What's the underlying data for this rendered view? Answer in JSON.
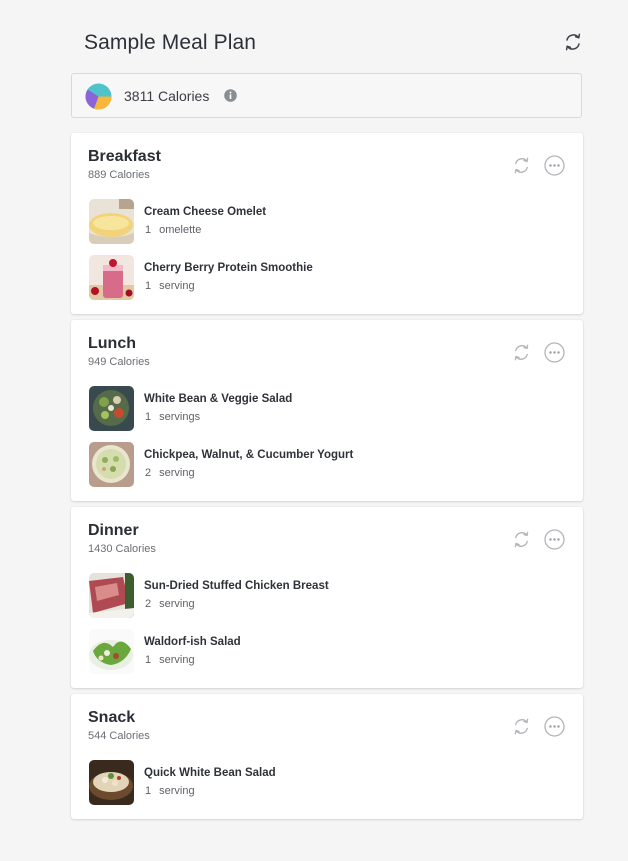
{
  "page": {
    "title": "Sample Meal Plan",
    "refresh_icon": "refresh-icon"
  },
  "summary": {
    "calories_text": "3811 Calories",
    "pie_icon": "macro-pie-chart-icon",
    "info_icon": "info-icon",
    "pie_colors": [
      "#4fc3c9",
      "#f6b73c",
      "#8d63d9"
    ]
  },
  "meals": [
    {
      "title": "Breakfast",
      "calories": "889 Calories",
      "items": [
        {
          "name": "Cream Cheese Omelet",
          "qty": "1",
          "unit": "omelette",
          "image": "omelet-photo"
        },
        {
          "name": "Cherry Berry Protein Smoothie",
          "qty": "1",
          "unit": "serving",
          "image": "smoothie-photo"
        }
      ]
    },
    {
      "title": "Lunch",
      "calories": "949 Calories",
      "items": [
        {
          "name": "White Bean & Veggie Salad",
          "qty": "1",
          "unit": "servings",
          "image": "bean-salad-photo"
        },
        {
          "name": "Chickpea, Walnut, & Cucumber Yogurt",
          "qty": "2",
          "unit": "serving",
          "image": "chickpea-yogurt-photo"
        }
      ]
    },
    {
      "title": "Dinner",
      "calories": "1430 Calories",
      "items": [
        {
          "name": "Sun-Dried Stuffed Chicken Breast",
          "qty": "2",
          "unit": "serving",
          "image": "chicken-photo"
        },
        {
          "name": "Waldorf-ish Salad",
          "qty": "1",
          "unit": "serving",
          "image": "waldorf-salad-photo"
        }
      ]
    },
    {
      "title": "Snack",
      "calories": "544 Calories",
      "items": [
        {
          "name": "Quick White Bean Salad",
          "qty": "1",
          "unit": "serving",
          "image": "white-bean-salad-photo"
        }
      ]
    }
  ],
  "icons": {
    "meal_refresh": "refresh-icon",
    "meal_more": "more-options-icon"
  }
}
